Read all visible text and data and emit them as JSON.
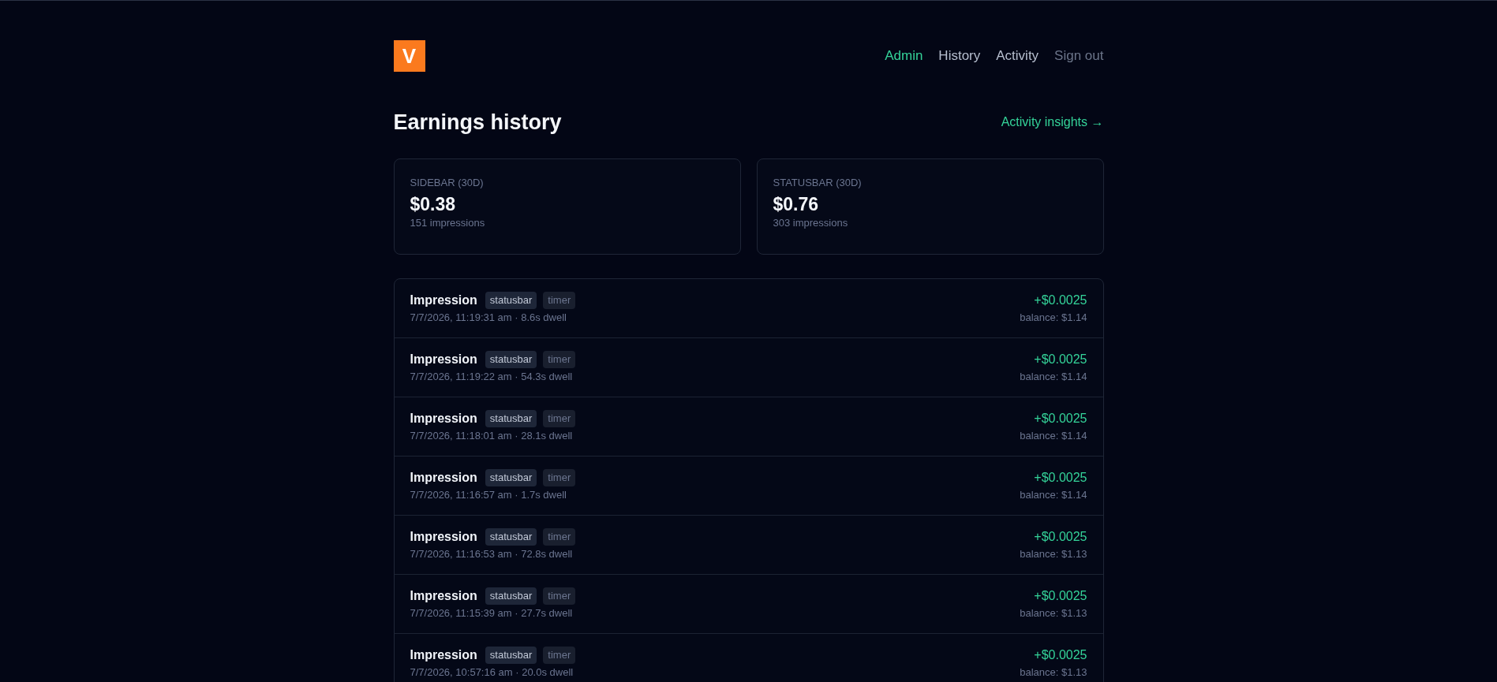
{
  "logo": {
    "text": "V"
  },
  "nav": [
    {
      "label": "Admin",
      "kind": "accent"
    },
    {
      "label": "History",
      "kind": "plain"
    },
    {
      "label": "Activity",
      "kind": "plain"
    },
    {
      "label": "Sign out",
      "kind": "muted"
    }
  ],
  "page": {
    "title": "Earnings history",
    "link": "Activity insights →"
  },
  "summary_cards": [
    {
      "label": "SIDEBAR (30D)",
      "amount": "$0.38",
      "impressions": "151 impressions"
    },
    {
      "label": "STATUSBAR (30D)",
      "amount": "$0.76",
      "impressions": "303 impressions"
    }
  ],
  "events": [
    {
      "title": "Impression",
      "tags": [
        {
          "label": "statusbar",
          "kind": "placement"
        },
        {
          "label": "timer",
          "kind": "trigger"
        }
      ],
      "time": "7/7/2026, 11:19:31 am · 8.6s dwell",
      "amount": "+$0.0025",
      "balance": "balance: $1.14"
    },
    {
      "title": "Impression",
      "tags": [
        {
          "label": "statusbar",
          "kind": "placement"
        },
        {
          "label": "timer",
          "kind": "trigger"
        }
      ],
      "time": "7/7/2026, 11:19:22 am · 54.3s dwell",
      "amount": "+$0.0025",
      "balance": "balance: $1.14"
    },
    {
      "title": "Impression",
      "tags": [
        {
          "label": "statusbar",
          "kind": "placement"
        },
        {
          "label": "timer",
          "kind": "trigger"
        }
      ],
      "time": "7/7/2026, 11:18:01 am · 28.1s dwell",
      "amount": "+$0.0025",
      "balance": "balance: $1.14"
    },
    {
      "title": "Impression",
      "tags": [
        {
          "label": "statusbar",
          "kind": "placement"
        },
        {
          "label": "timer",
          "kind": "trigger"
        }
      ],
      "time": "7/7/2026, 11:16:57 am · 1.7s dwell",
      "amount": "+$0.0025",
      "balance": "balance: $1.14"
    },
    {
      "title": "Impression",
      "tags": [
        {
          "label": "statusbar",
          "kind": "placement"
        },
        {
          "label": "timer",
          "kind": "trigger"
        }
      ],
      "time": "7/7/2026, 11:16:53 am · 72.8s dwell",
      "amount": "+$0.0025",
      "balance": "balance: $1.13"
    },
    {
      "title": "Impression",
      "tags": [
        {
          "label": "statusbar",
          "kind": "placement"
        },
        {
          "label": "timer",
          "kind": "trigger"
        }
      ],
      "time": "7/7/2026, 11:15:39 am · 27.7s dwell",
      "amount": "+$0.0025",
      "balance": "balance: $1.13"
    },
    {
      "title": "Impression",
      "tags": [
        {
          "label": "statusbar",
          "kind": "placement"
        },
        {
          "label": "timer",
          "kind": "trigger"
        }
      ],
      "time": "7/7/2026, 10:57:16 am · 20.0s dwell",
      "amount": "+$0.0025",
      "balance": "balance: $1.13"
    }
  ]
}
